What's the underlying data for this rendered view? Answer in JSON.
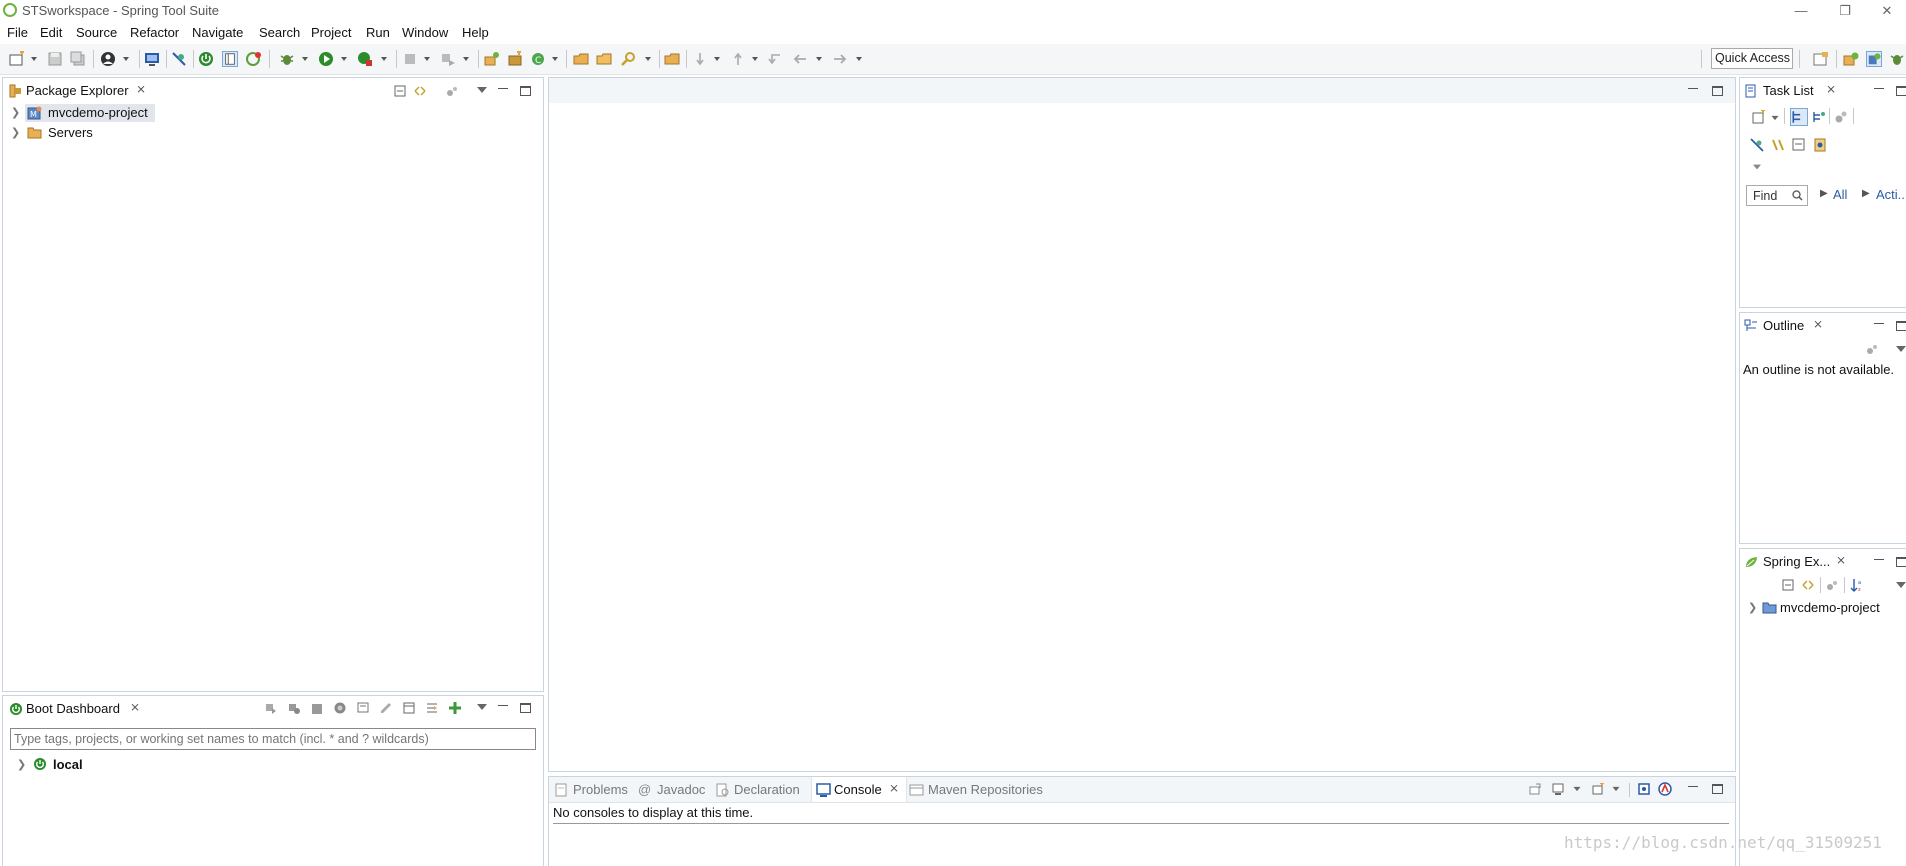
{
  "window": {
    "title": "STSworkspace - Spring Tool Suite",
    "min_icon": "minimize-icon",
    "restore_icon": "restore-icon",
    "close_icon": "close-icon"
  },
  "menu": [
    "File",
    "Edit",
    "Source",
    "Refactor",
    "Navigate",
    "Search",
    "Project",
    "Run",
    "Window",
    "Help"
  ],
  "toolbar": {
    "quick_access": "Quick Access"
  },
  "package_explorer": {
    "title": "Package Explorer",
    "items": [
      {
        "label": "mvcdemo-project",
        "icon": "project-icon"
      },
      {
        "label": "Servers",
        "icon": "folder-icon"
      }
    ]
  },
  "boot_dashboard": {
    "title": "Boot Dashboard",
    "filter_placeholder": "Type tags, projects, or working set names to match (incl. * and ? wildcards)",
    "items": [
      {
        "label": "local",
        "icon": "spring-boot-icon"
      }
    ]
  },
  "bottom_panel": {
    "tabs": [
      "Problems",
      "Javadoc",
      "Declaration",
      "Console",
      "Maven Repositories"
    ],
    "active_tab": "Console",
    "message": "No consoles to display at this time."
  },
  "task_list": {
    "title": "Task List",
    "find_placeholder": "Find",
    "filters": [
      "All",
      "Acti..."
    ]
  },
  "outline": {
    "title": "Outline",
    "message": "An outline is not available."
  },
  "spring_explorer": {
    "title": "Spring Ex...",
    "items": [
      {
        "label": "mvcdemo-project"
      }
    ]
  },
  "watermark": "https://blog.csdn.net/qq_31509251",
  "colors": {
    "spring_green": "#6db33f",
    "panel_border": "#c8d4e0",
    "active_tab_bg": "#ffffff"
  }
}
